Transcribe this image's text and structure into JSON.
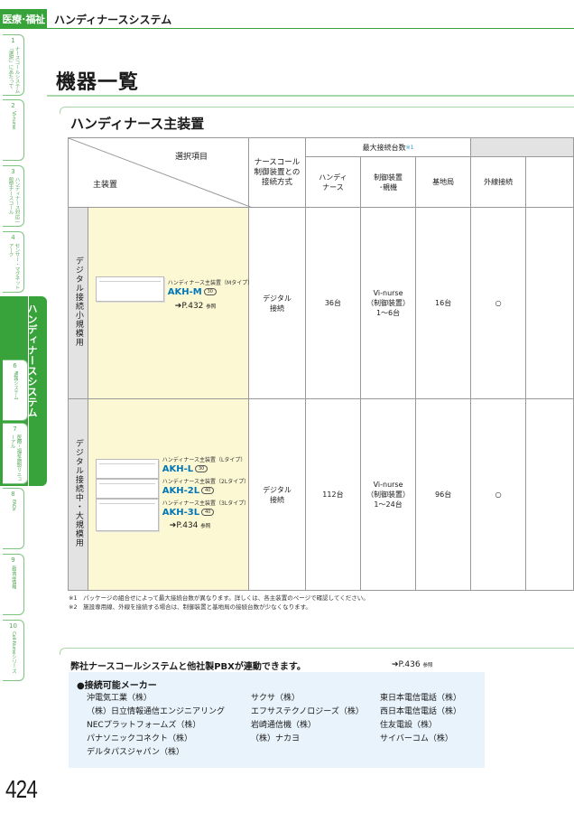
{
  "header": {
    "category": "医療･福祉",
    "title": "ハンディナースシステム"
  },
  "side_tabs": [
    {
      "num": "1",
      "label": "ナースコールシステム「選択」にあたって"
    },
    {
      "num": "2",
      "label": "Vi-nurse"
    },
    {
      "num": "3",
      "label": "ハンディナース対応一般型ナースコール"
    },
    {
      "num": "4",
      "label": "センサー・マグネットアーク"
    },
    {
      "num": "5",
      "label": "ハンディナースシステム"
    },
    {
      "num": "6",
      "label": "通報システム"
    },
    {
      "num": "7",
      "label": "医療・福祉施設リニューアル"
    },
    {
      "num": "8",
      "label": "FAQs"
    },
    {
      "num": "9",
      "label": "新商品情報"
    },
    {
      "num": "10",
      "label": "Cell-Nurseシリーズ"
    }
  ],
  "page_heading": "機器一覧",
  "section_heading": "ハンディナース主装置",
  "table": {
    "corner_top": "選択項目",
    "corner_bottom": "主装置",
    "col_connect": "ナースコール\n制御装置との\n接続方式",
    "group_max": "最大接続台数",
    "group_max_note": "※1",
    "col_handy": "ハンディ\nナース",
    "col_control": "制御装置\n･親機",
    "col_base": "基地局",
    "col_outer": "外線接続",
    "rows": [
      {
        "category": "デジタル接続小規模用",
        "models": [
          {
            "sub": "ハンディナース主装置（Mタイプ）",
            "code": "AKH-M",
            "badge": "30"
          }
        ],
        "page_ref": "P.432",
        "ref_suffix": "参照",
        "connect": "デジタル\n接続",
        "handy": "36台",
        "control": "Vi-nurse\n（制御装置）\n1～6台",
        "base": "16台",
        "outer": "○"
      },
      {
        "category": "デジタル接続中・大規模用",
        "models": [
          {
            "sub": "ハンディナース主装置（Lタイプ）",
            "code": "AKH-L",
            "badge": "30"
          },
          {
            "sub": "ハンディナース主装置（2Lタイプ）",
            "code": "AKH-2L",
            "badge": "40"
          },
          {
            "sub": "ハンディナース主装置（3Lタイプ）",
            "code": "AKH-3L",
            "badge": "40"
          }
        ],
        "page_ref": "P.434",
        "ref_suffix": "参照",
        "connect": "デジタル\n接続",
        "handy": "112台",
        "control": "Vi-nurse\n（制御装置）\n1～24台",
        "base": "96台",
        "outer": "○"
      }
    ]
  },
  "footnotes": [
    "※1　パッケージの組合せによって最大接続台数が異なります。詳しくは、各主装置のページで確認してください。",
    "※2　施設専用線、外線を接続する場合は、制御装置と基地局の接続台数が少なくなります。"
  ],
  "pbx": {
    "heading": "弊社ナースコールシステムと他社製PBXが連動できます。",
    "page_ref": "P.436",
    "ref_suffix": "参照",
    "makers_heading": "●接続可能メーカー",
    "makers_col1": [
      "沖電気工業（株）",
      "（株）日立情報通信エンジニアリング",
      "NECプラットフォームズ（株）",
      "パナソニックコネクト（株）",
      "デルタパスジャパン（株）"
    ],
    "makers_col2": [
      "サクサ（株）",
      "エフサステクノロジーズ（株）",
      "岩崎通信機（株）",
      "（株）ナカヨ"
    ],
    "makers_col3": [
      "東日本電信電話（株）",
      "西日本電信電話（株）",
      "住友電設（株）",
      "サイバーコム（株）"
    ]
  },
  "page_number": "424",
  "colors": {
    "accent_green": "#38a33b",
    "model_blue": "#0076b6",
    "highlight_yellow": "#fdf8d4",
    "maker_box": "#e8f3fb"
  }
}
